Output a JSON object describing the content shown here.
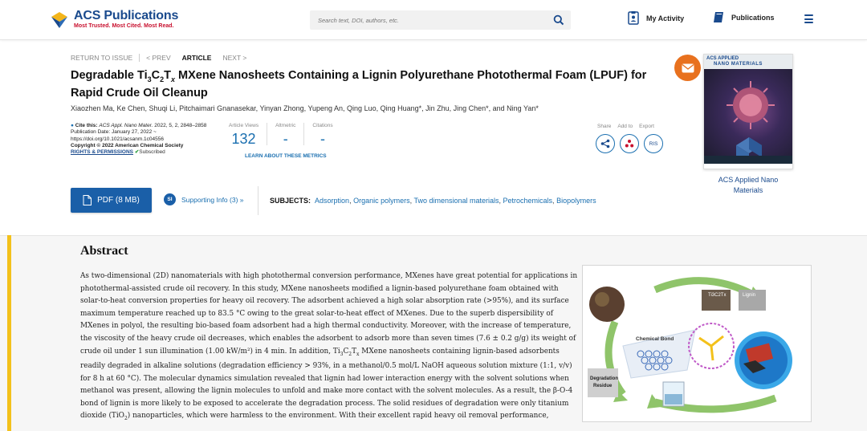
{
  "header": {
    "logo_name": "ACS Publications",
    "logo_tagline": "Most Trusted. Most Cited. Most Read.",
    "search_placeholder": "Search text, DOI, authors, etc.",
    "my_activity": "My Activity",
    "publications": "Publications"
  },
  "article_nav": {
    "return": "RETURN TO ISSUE",
    "prev": "< PREV",
    "article": "ARTICLE",
    "next": "NEXT >"
  },
  "article": {
    "title_part1": "Degradable Ti",
    "title_sub1": "3",
    "title_part2": "C",
    "title_sub2": "2",
    "title_part3": "T",
    "title_sub3": "x",
    "title_part4": " MXene Nanosheets Containing a Lignin Polyurethane Photothermal Foam (LPUF) for Rapid Crude Oil Cleanup",
    "authors": "Xiaozhen Ma, Ke Chen, Shuqi Li, Pitchaimari Gnanasekar, Yinyan Zhong, Yupeng An, Qing Luo, Qing Huang*, Jin Zhu, Jing Chen*, and Ning Yan*"
  },
  "citation": {
    "cite_label": "Cite this:",
    "journal": "ACS Appl. Nano Mater.",
    "ref": "2022, 5, 2, 2848–2858",
    "pub_date": "Publication Date: January 27, 2022 ~",
    "doi": "https://doi.org/10.1021/acsanm.1c04556",
    "copyright": "Copyright © 2022 American Chemical Society",
    "rights": "RIGHTS & PERMISSIONS",
    "subscribed": "Subscribed"
  },
  "metrics": {
    "views_label": "Article Views",
    "views_value": "132",
    "altmetric_label": "Altmetric",
    "altmetric_value": "-",
    "citations_label": "Citations",
    "citations_value": "-",
    "learn_more": "LEARN ABOUT THESE METRICS"
  },
  "share": {
    "share_label": "Share",
    "add_label": "Add to",
    "export_label": "Export",
    "ris": "RIS"
  },
  "actions": {
    "pdf": "PDF (8 MB)",
    "si_badge": "SI",
    "si_label": "Supporting Info (3) »",
    "subjects_label": "SUBJECTS:",
    "subjects": [
      "Adsorption",
      "Organic polymers",
      "Two dimensional materials",
      "Petrochemicals",
      "Biopolymers"
    ]
  },
  "cover": {
    "line1": "ACS APPLIED",
    "line2": "NANO MATERIALS",
    "journal_name": "ACS Applied Nano Materials"
  },
  "abstract": {
    "heading": "Abstract",
    "p1": "As two-dimensional (2D) nanomaterials with high photothermal conversion performance, MXenes have great potential for applications in photothermal-assisted crude oil recovery. In this study, MXene nanosheets modified a lignin-based polyurethane foam obtained with solar-to-heat conversion properties for heavy oil recovery. The adsorbent achieved a high solar absorption rate (>95%), and its surface maximum temperature reached up to 83.5 °C owing to the great solar-to-heat effect of MXenes. Due to the superb dispersibility of MXenes in polyol, the resulting bio-based foam adsorbent had a high thermal conductivity. Moreover, with the increase of temperature, the viscosity of the heavy crude oil decreases, which enables the adsorbent to adsorb more than seven times (7.6 ± 0.2 g/g) its weight of crude oil under 1 sun illumination (1.00 kW/m²) in 4 min. In addition, ",
    "p2_ti": "Ti",
    "p2_s3": "3",
    "p2_c": "C",
    "p2_s2": "2",
    "p2_t": "T",
    "p2_sx": "x",
    "p2_rest": " MXene nanosheets containing lignin-based adsorbents readily degraded in alkaline solutions (degradation efficiency > 93%, in a methanol/0.5 mol/L NaOH aqueous solution mixture (1:1, v/v) for 8 h at 60 °C). The molecular dynamics simulation revealed that lignin had lower interaction energy with the solvent solutions when methanol was present, allowing the lignin molecules to unfold and make more contact with the solvent molecules. As a result, the β-O-4 bond of lignin is more likely to be exposed to accelerate the degradation process. The solid residues of degradation were only titanium dioxide (TiO",
    "p2_s2b": "2",
    "p2_end": ") nanoparticles, which were harmless to the environment. With their excellent rapid heavy oil removal performance,"
  },
  "toc_graphic": {
    "label_mxene": "Ti3C2Tx",
    "label_lignin": "Lignin",
    "label_bond": "Chemical Bond",
    "label_residue_1": "Degradation",
    "label_residue_2": "Residue"
  },
  "colors": {
    "brand_blue": "#1a4a8d",
    "link_blue": "#1a6fb0",
    "pdf_button": "#1a5fa8",
    "accent_yellow": "#f3c11b",
    "mail_orange": "#e8711e"
  }
}
